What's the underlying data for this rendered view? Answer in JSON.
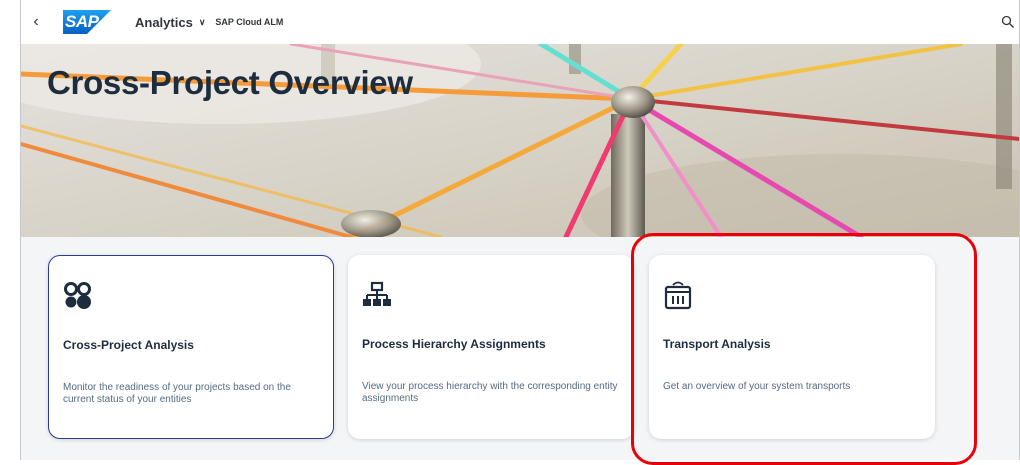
{
  "shell": {
    "back_icon": "chevron-left-icon",
    "logo_text": "SAP",
    "app_title": "Analytics",
    "app_subtitle": "SAP Cloud ALM",
    "search_icon": "search-icon",
    "brand_color": "#0a6ed1"
  },
  "hero": {
    "title": "Cross-Project Overview"
  },
  "cards": [
    {
      "icon": "circles-grid-icon",
      "title": "Cross-Project Analysis",
      "description": "Monitor the readiness of your projects based on the current status of your entities"
    },
    {
      "icon": "hierarchy-icon",
      "title": "Process Hierarchy Assignments",
      "description": "View your process hierarchy with the corresponding entity assignments"
    },
    {
      "icon": "transport-container-icon",
      "title": "Transport Analysis",
      "description": "Get an overview of your system transports"
    }
  ],
  "highlight_color": "#e8000b"
}
